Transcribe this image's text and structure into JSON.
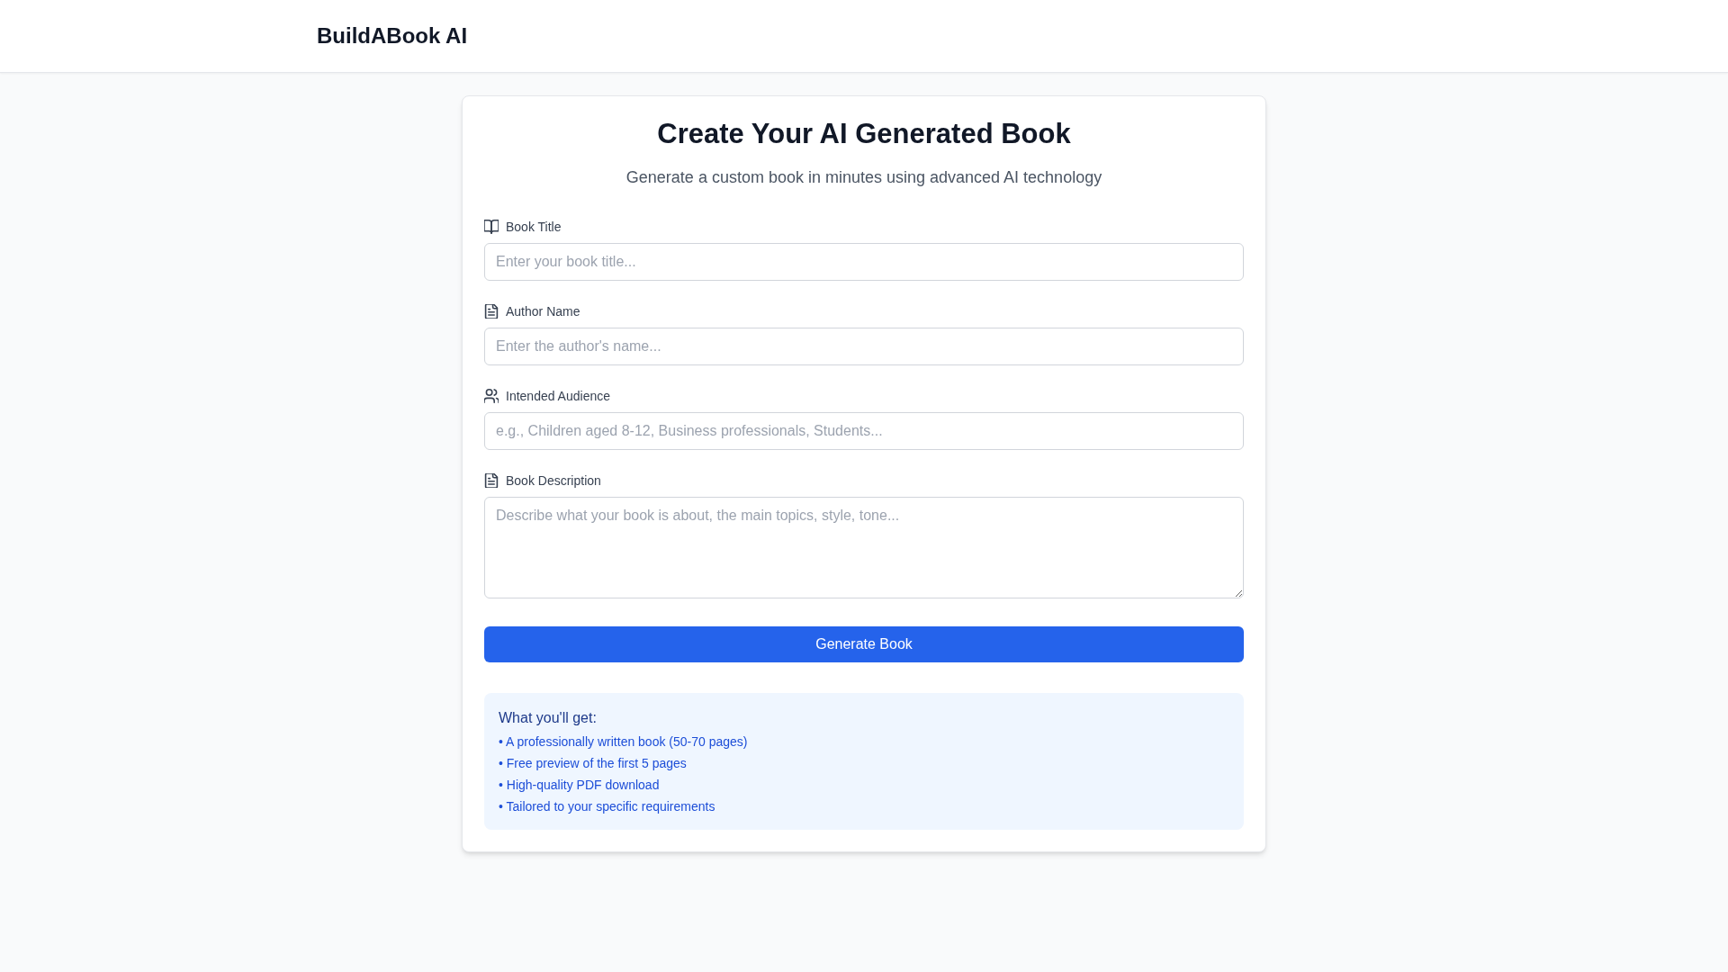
{
  "header": {
    "brand": "BuildABook AI"
  },
  "form": {
    "title": "Create Your AI Generated Book",
    "subtitle": "Generate a custom book in minutes using advanced AI technology",
    "fields": [
      {
        "kind": "input",
        "label": "Book Title",
        "placeholder": "Enter your book title..."
      },
      {
        "kind": "input",
        "label": "Author Name",
        "placeholder": "Enter the author's name..."
      },
      {
        "kind": "input",
        "label": "Intended Audience",
        "placeholder": "e.g., Children aged 8-12, Business professionals, Students..."
      },
      {
        "kind": "textarea",
        "label": "Book Description",
        "placeholder": "Describe what your book is about, the main topics, style, tone..."
      }
    ],
    "submit_button": "Generate Book"
  },
  "info_box": {
    "title": "What you'll get:",
    "items": [
      "• A professionally written book (50-70 pages)",
      "• Free preview of the first 5 pages",
      "• High-quality PDF download",
      "• Tailored to your specific requirements"
    ]
  }
}
